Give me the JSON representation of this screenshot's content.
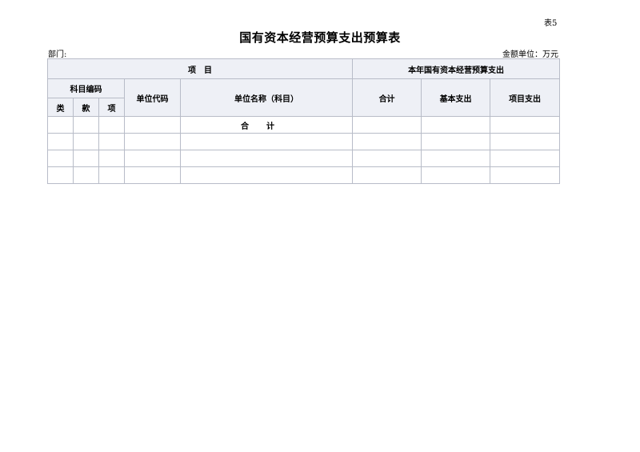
{
  "table_no": "表5",
  "title": "国有资本经营预算支出预算表",
  "department_label": "部门:",
  "unit_label": "金额单位：万元",
  "header": {
    "project": "项　目",
    "current_year": "本年国有资本经营预算支出",
    "subject_code": "科目编码",
    "category": "类",
    "section": "款",
    "item": "项",
    "unit_code": "单位代码",
    "unit_name": "单位名称（科目）",
    "total": "合计",
    "basic_expense": "基本支出",
    "project_expense": "项目支出"
  },
  "rows": [
    {
      "lei": "",
      "kuan": "",
      "xiang": "",
      "code": "",
      "name": "合计",
      "total": "",
      "basic": "",
      "project": ""
    },
    {
      "lei": "",
      "kuan": "",
      "xiang": "",
      "code": "",
      "name": "",
      "total": "",
      "basic": "",
      "project": ""
    },
    {
      "lei": "",
      "kuan": "",
      "xiang": "",
      "code": "",
      "name": "",
      "total": "",
      "basic": "",
      "project": ""
    },
    {
      "lei": "",
      "kuan": "",
      "xiang": "",
      "code": "",
      "name": "",
      "total": "",
      "basic": "",
      "project": ""
    }
  ]
}
